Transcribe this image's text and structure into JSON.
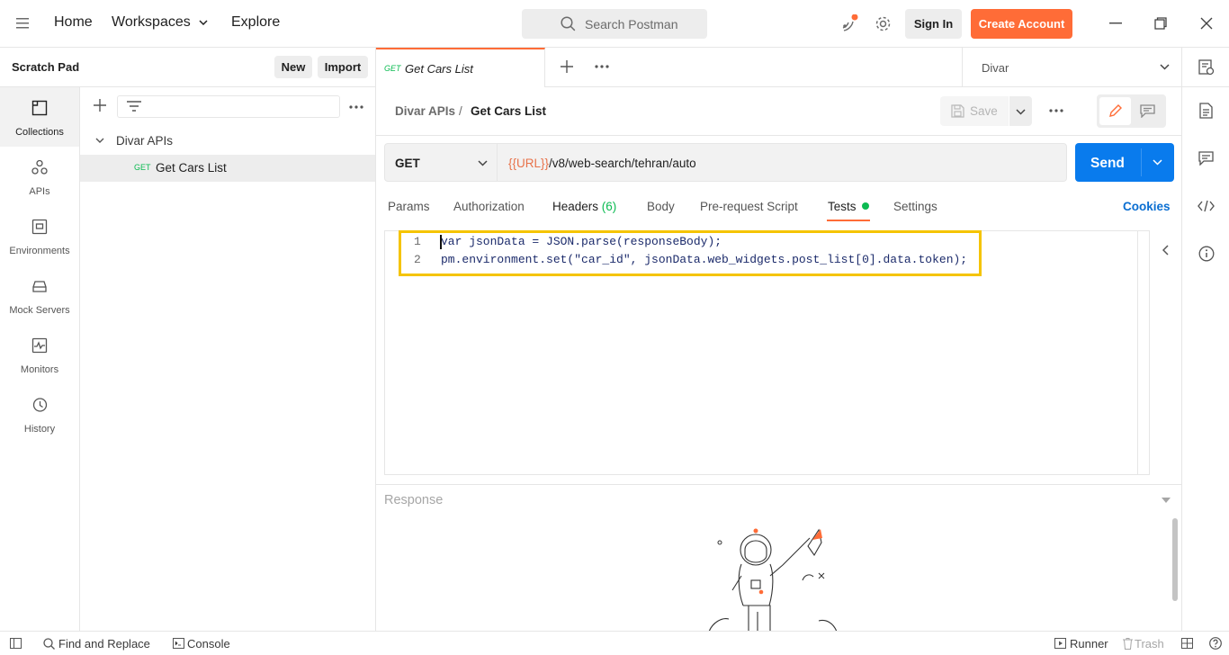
{
  "nav": {
    "home": "Home",
    "workspaces": "Workspaces",
    "explore": "Explore",
    "search_placeholder": "Search Postman",
    "sign_in": "Sign In",
    "create_account": "Create Account"
  },
  "sidebar": {
    "title": "Scratch Pad",
    "new_label": "New",
    "import_label": "Import",
    "rail": [
      {
        "label": "Collections",
        "icon": "collections-icon"
      },
      {
        "label": "APIs",
        "icon": "apis-icon"
      },
      {
        "label": "Environments",
        "icon": "environments-icon"
      },
      {
        "label": "Mock Servers",
        "icon": "mock-servers-icon"
      },
      {
        "label": "Monitors",
        "icon": "monitors-icon"
      },
      {
        "label": "History",
        "icon": "history-icon"
      }
    ],
    "collection": {
      "name": "Divar APIs",
      "request_method": "GET",
      "request_name": "Get Cars List"
    }
  },
  "tabs": {
    "active_method": "GET",
    "active_name": "Get Cars List",
    "environment": "Divar"
  },
  "request": {
    "breadcrumb_parent": "Divar APIs",
    "breadcrumb_sep": "/",
    "breadcrumb_current": "Get Cars List",
    "save_label": "Save",
    "method": "GET",
    "url_var": "{{URL}}",
    "url_path": "/v8/web-search/tehran/auto",
    "send_label": "Send",
    "subtabs": {
      "params": "Params",
      "authorization": "Authorization",
      "headers": "Headers",
      "headers_count": "(6)",
      "body": "Body",
      "prerequest": "Pre-request Script",
      "tests": "Tests",
      "settings": "Settings",
      "cookies": "Cookies"
    },
    "code_lines": [
      {
        "num": "1",
        "text": "var jsonData = JSON.parse(responseBody);"
      },
      {
        "num": "2",
        "text": "pm.environment.set(\"car_id\", jsonData.web_widgets.post_list[0].data.token);"
      }
    ]
  },
  "response": {
    "title": "Response"
  },
  "statusbar": {
    "find_replace": "Find and Replace",
    "console": "Console",
    "runner": "Runner",
    "trash": "Trash"
  },
  "colors": {
    "accent": "#ff6c37",
    "send_blue": "#097bed",
    "highlight": "#f5c400",
    "get_green": "#0cbb52"
  }
}
